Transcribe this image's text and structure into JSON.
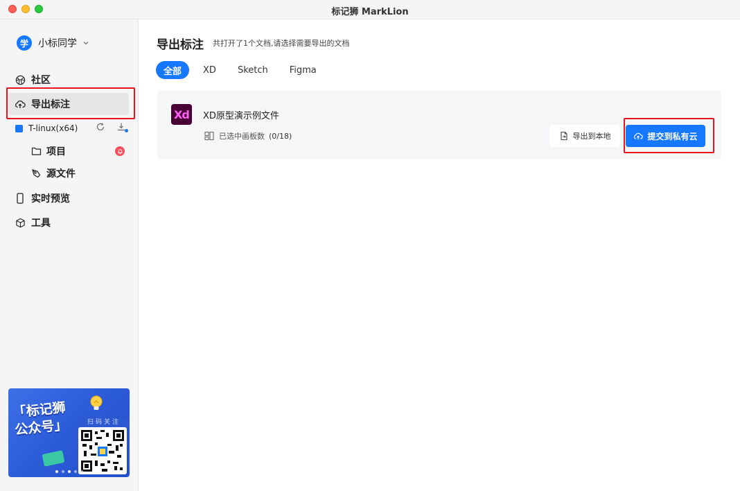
{
  "window": {
    "title": "标记狮 MarkLion"
  },
  "sidebar": {
    "user": {
      "avatar_text": "学",
      "name": "小标同学"
    },
    "nav": [
      {
        "label": "社区",
        "icon": "globe-icon"
      },
      {
        "label": "导出标注",
        "icon": "cloud-upload-icon",
        "active": true
      },
      {
        "label": "实时预览",
        "icon": "phone-icon"
      },
      {
        "label": "工具",
        "icon": "cube-icon"
      }
    ],
    "project": {
      "name": "T-linux(x64)",
      "color": "#1677ff",
      "items": [
        {
          "label": "项目",
          "icon": "folder-icon",
          "alert": true
        },
        {
          "label": "源文件",
          "icon": "pen-tool-icon"
        }
      ]
    },
    "promo": {
      "line1": "「标记狮",
      "line2": "公众号」",
      "qr_label": "扫码关注"
    }
  },
  "main": {
    "title": "导出标注",
    "subtitle": "共打开了1个文档,请选择需要导出的文档",
    "tabs": [
      {
        "label": "全部",
        "active": true
      },
      {
        "label": "XD"
      },
      {
        "label": "Sketch"
      },
      {
        "label": "Figma"
      }
    ],
    "documents": [
      {
        "logo_text": "Xd",
        "name": "XD原型演示例文件",
        "selected_label": "已选中画板数",
        "selected_count": "(0/18)",
        "export_local_label": "导出到本地",
        "submit_cloud_label": "提交到私有云"
      }
    ]
  },
  "colors": {
    "accent": "#1677ff",
    "highlight": "#e8141c",
    "xd_bg": "#470137",
    "xd_fg": "#ff61f6"
  }
}
